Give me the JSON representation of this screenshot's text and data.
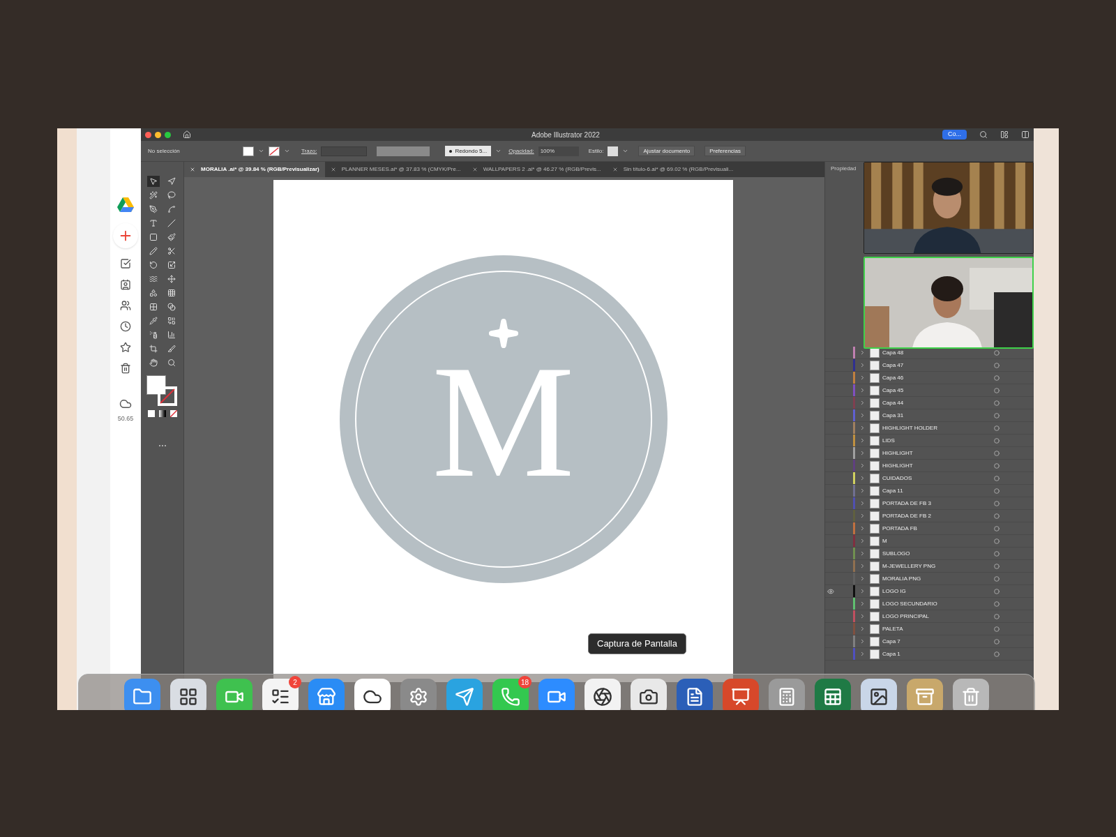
{
  "window": {
    "title": "Adobe Illustrator 2022",
    "share_button": "Co..."
  },
  "control_bar": {
    "selection": "No selección",
    "stroke_label": "Trazo:",
    "brush": "Redondo 5...",
    "opacity_label": "Opacidad:",
    "opacity": "100%",
    "style_label": "Estilo:",
    "buttons": [
      "Ajustar documento",
      "Preferencias"
    ]
  },
  "tabs": [
    {
      "label": "MORALIA .ai* @ 39.84 % (RGB/Previsualizar)",
      "selected": true
    },
    {
      "label": "PLANNER MESES.ai* @ 37.83 % (CMYK/Pre...",
      "selected": false
    },
    {
      "label": "WALLPAPERS 2 .ai* @ 46.27 % (RGB/Previs...",
      "selected": false
    },
    {
      "label": "Sin título-6.ai* @ 69.02 % (RGB/Previsuali...",
      "selected": false
    }
  ],
  "tools": [
    {
      "kind": "select",
      "selected": true
    },
    {
      "kind": "direct",
      "selected": false
    },
    {
      "kind": "wand",
      "selected": false
    },
    {
      "kind": "lasso",
      "selected": false
    },
    {
      "kind": "pen",
      "selected": false
    },
    {
      "kind": "curvature",
      "selected": false
    },
    {
      "kind": "type",
      "selected": false
    },
    {
      "kind": "line",
      "selected": false
    },
    {
      "kind": "rect",
      "selected": false
    },
    {
      "kind": "brush",
      "selected": false
    },
    {
      "kind": "pencil",
      "selected": false
    },
    {
      "kind": "scissors",
      "selected": false
    },
    {
      "kind": "rotate",
      "selected": false
    },
    {
      "kind": "scale",
      "selected": false
    },
    {
      "kind": "warp",
      "selected": false
    },
    {
      "kind": "transform",
      "selected": false
    },
    {
      "kind": "shape",
      "selected": false
    },
    {
      "kind": "grid",
      "selected": false
    },
    {
      "kind": "mesh",
      "selected": false
    },
    {
      "kind": "gradient",
      "selected": false
    },
    {
      "kind": "eyedropper",
      "selected": false
    },
    {
      "kind": "blend",
      "selected": false
    },
    {
      "kind": "spray",
      "selected": false
    },
    {
      "kind": "chart",
      "selected": false
    },
    {
      "kind": "artboard",
      "selected": false
    },
    {
      "kind": "slice",
      "selected": false
    },
    {
      "kind": "hand",
      "selected": false
    },
    {
      "kind": "zoom",
      "selected": false
    }
  ],
  "artboard": {
    "monogram": "M"
  },
  "drive_sidebar": {
    "storage": "50.65"
  },
  "panel": {
    "title": "Propiedad"
  },
  "video_tiles": [
    {
      "kind": "picture",
      "active": false
    },
    {
      "kind": "picture",
      "active": true
    }
  ],
  "layers": [
    {
      "name": "Capa 48",
      "color": "#c080b0",
      "visible": false
    },
    {
      "name": "Capa 47",
      "color": "#303090",
      "visible": false
    },
    {
      "name": "Capa 46",
      "color": "#c08040",
      "visible": false
    },
    {
      "name": "Capa 45",
      "color": "#8050c0",
      "visible": false
    },
    {
      "name": "Capa 44",
      "color": "#804050",
      "visible": false
    },
    {
      "name": "Capa 31",
      "color": "#6060d0",
      "visible": false
    },
    {
      "name": "HIGHLIGHT HOLDER",
      "color": "#a08060",
      "visible": false
    },
    {
      "name": "LIDS",
      "color": "#c09040",
      "visible": false
    },
    {
      "name": "HIGHLIGHT",
      "color": "#a0a0a0",
      "visible": false
    },
    {
      "name": "HIGHLIGHT",
      "color": "#604080",
      "visible": false
    },
    {
      "name": "CUIDADOS",
      "color": "#d0d060",
      "visible": false
    },
    {
      "name": "Capa 11",
      "color": "#707090",
      "visible": false
    },
    {
      "name": "PORTADA DE FB 3",
      "color": "#5050b0",
      "visible": false
    },
    {
      "name": "PORTADA DE FB 2",
      "color": "#606040",
      "visible": false
    },
    {
      "name": "PORTADA FB",
      "color": "#c07040",
      "visible": false
    },
    {
      "name": "M",
      "color": "#803040",
      "visible": false
    },
    {
      "name": "SUBLOGO",
      "color": "#709050",
      "visible": false
    },
    {
      "name": "M-JEWELLERY PNG",
      "color": "#907050",
      "visible": false
    },
    {
      "name": "MORALIA PNG",
      "color": "#606060",
      "visible": false
    },
    {
      "name": "LOGO IG",
      "color": "#101010",
      "visible": true
    },
    {
      "name": "LOGO SECUNDARIO",
      "color": "#60c070",
      "visible": false
    },
    {
      "name": "LOGO PRINCIPAL",
      "color": "#c05060",
      "visible": false
    },
    {
      "name": "PALETA",
      "color": "#805040",
      "visible": false
    },
    {
      "name": "Capa 7",
      "color": "#808080",
      "visible": false
    },
    {
      "name": "Capa 1",
      "color": "#5050c0",
      "visible": false
    }
  ],
  "tooltip": "Captura de Pantalla",
  "dock": [
    {
      "kind": "finder"
    },
    {
      "kind": "launchpad"
    },
    {
      "kind": "facetime"
    },
    {
      "kind": "reminders",
      "badge": "2"
    },
    {
      "kind": "appstore"
    },
    {
      "kind": "onedrive"
    },
    {
      "kind": "settings"
    },
    {
      "kind": "telegram"
    },
    {
      "kind": "whatsapp",
      "badge": "18"
    },
    {
      "kind": "zoom"
    },
    {
      "kind": "chrome"
    },
    {
      "kind": "screenshot"
    },
    {
      "kind": "word"
    },
    {
      "kind": "powerpoint"
    },
    {
      "kind": "calculator"
    },
    {
      "kind": "excel"
    },
    {
      "kind": "preview"
    },
    {
      "kind": "archive"
    },
    {
      "kind": "trash"
    }
  ]
}
